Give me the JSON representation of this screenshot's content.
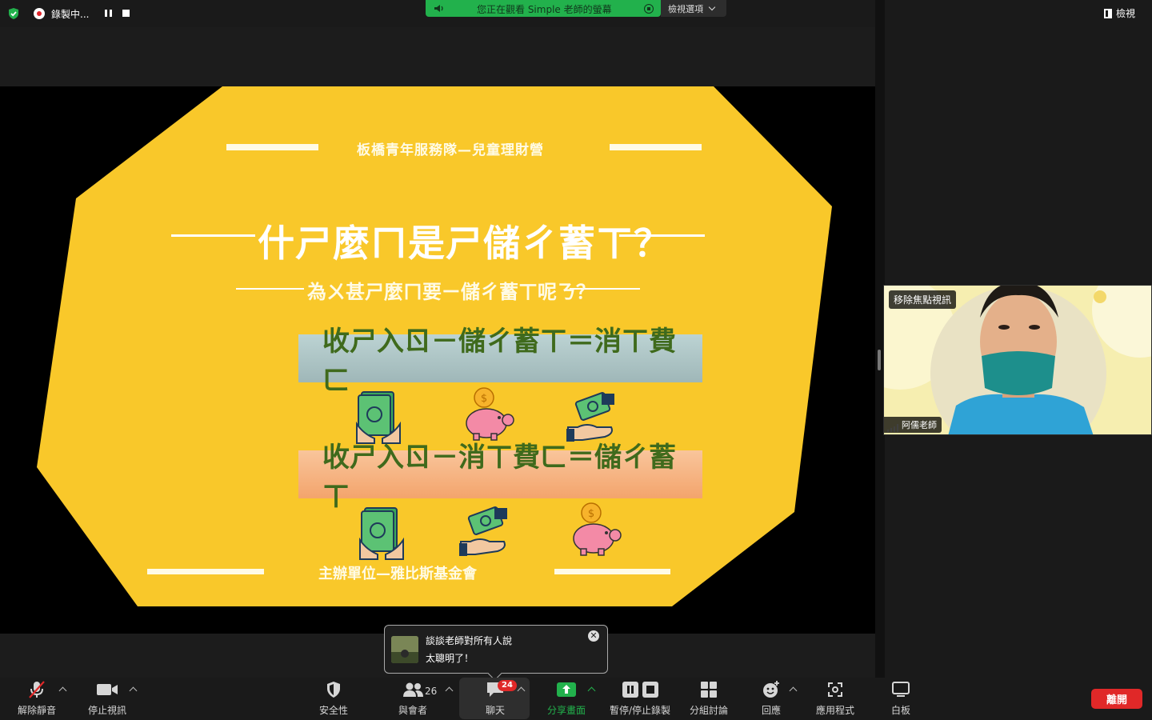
{
  "topbar": {
    "recording_label": "錄製中...",
    "share_banner_text": "您正在觀看 Simple 老師的螢幕",
    "view_options_label": "檢視選項",
    "view_label": "檢視"
  },
  "slide": {
    "header": "板橋青年服務隊—兒童理財營",
    "title": "什ㄕ麼ㄇ是ㄕ儲ㄔ蓄ㄒ？",
    "subtitle": "為ㄨ甚ㄕ麼ㄇ要ㄧ儲ㄔ蓄ㄒ呢ㄋ？",
    "formula_1": "收ㄕ入ㄖ－儲ㄔ蓄ㄒ＝消ㄒ費ㄈ",
    "formula_2": "收ㄕ入ㄖ－消ㄒ費ㄈ＝儲ㄔ蓄ㄒ",
    "footer": "主辦單位—雅比斯基金會",
    "colors": {
      "background": "#f9c82a",
      "formula_1": "#a7bfc0",
      "formula_2": "#f5ad75",
      "formula_text": "#3f6a1c"
    }
  },
  "video": {
    "remove_spotlight_label": "移除焦點視訊",
    "participant_name": "阿儒老師"
  },
  "chat_toast": {
    "sender": "談談老師對所有人說",
    "message": "太聰明了！",
    "close_symbol": "✕"
  },
  "toolbar": {
    "unmute_label": "解除靜音",
    "stop_video_label": "停止視訊",
    "security_label": "安全性",
    "participants_label": "與會者",
    "participants_count": "26",
    "chat_label": "聊天",
    "chat_badge": "24",
    "share_label": "分享畫面",
    "record_label": "暫停/停止錄製",
    "breakout_label": "分組討論",
    "reactions_label": "回應",
    "apps_label": "應用程式",
    "whiteboard_label": "白板",
    "leave_label": "離開"
  }
}
